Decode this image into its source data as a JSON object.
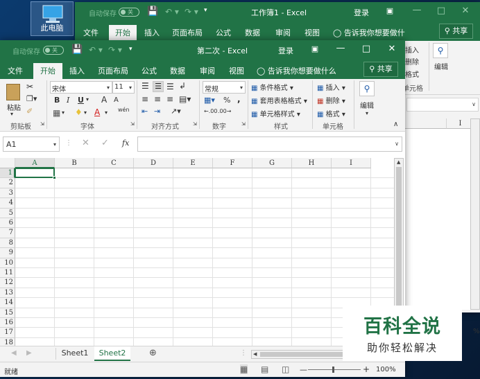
{
  "desktop": {
    "icon_label": "此电脑"
  },
  "back_window": {
    "title": "工作簿1 - Excel",
    "autosave": "自动保存",
    "toggle": "关",
    "login": "登录",
    "tabs": [
      "文件",
      "开始",
      "插入",
      "页面布局",
      "公式",
      "数据",
      "审阅",
      "视图"
    ],
    "tell_me": "告诉我你想要做什么",
    "share": "共享",
    "cells": {
      "insert": "插入",
      "delete": "删除",
      "format": "格式",
      "group": "单元格"
    },
    "edit": "编辑"
  },
  "front_window": {
    "title": "第二次 - Excel",
    "autosave": "自动保存",
    "toggle": "关",
    "login": "登录",
    "tabs": [
      "文件",
      "开始",
      "插入",
      "页面布局",
      "公式",
      "数据",
      "审阅",
      "视图"
    ],
    "tell_me": "告诉我你想要做什么",
    "share": "共享",
    "clipboard": {
      "paste": "粘贴",
      "group": "剪贴板"
    },
    "font": {
      "name": "宋体",
      "size": "11",
      "bold": "B",
      "italic": "I",
      "underline": "U",
      "grow": "A",
      "shrink": "A",
      "font_color": "A",
      "phonetic": "wén",
      "group": "字体"
    },
    "alignment": {
      "group": "对齐方式"
    },
    "number": {
      "format": "常规",
      "percent": "%",
      "comma": ",",
      "group": "数字"
    },
    "styles": {
      "conditional": "条件格式",
      "table": "套用表格格式",
      "cell_styles": "单元格样式",
      "group": "样式"
    },
    "cells": {
      "insert": "插入",
      "delete": "删除",
      "format": "格式",
      "group": "单元格"
    },
    "edit": "编辑",
    "name_box": "A1",
    "fx": "fx",
    "columns": [
      "A",
      "B",
      "C",
      "D",
      "E",
      "F",
      "G",
      "H",
      "I"
    ],
    "rows": [
      "1",
      "2",
      "3",
      "4",
      "5",
      "6",
      "7",
      "8",
      "9",
      "10",
      "11",
      "12",
      "13",
      "14",
      "15",
      "16",
      "17",
      "18"
    ],
    "sheets": [
      "Sheet1",
      "Sheet2"
    ],
    "active_sheet": "Sheet2",
    "status": "就绪",
    "zoom": "100%"
  },
  "back_grid": {
    "col_label": "I",
    "zoom_partial": "%"
  },
  "watermark": {
    "line1": "百科全说",
    "line2": "助你轻松解决"
  }
}
